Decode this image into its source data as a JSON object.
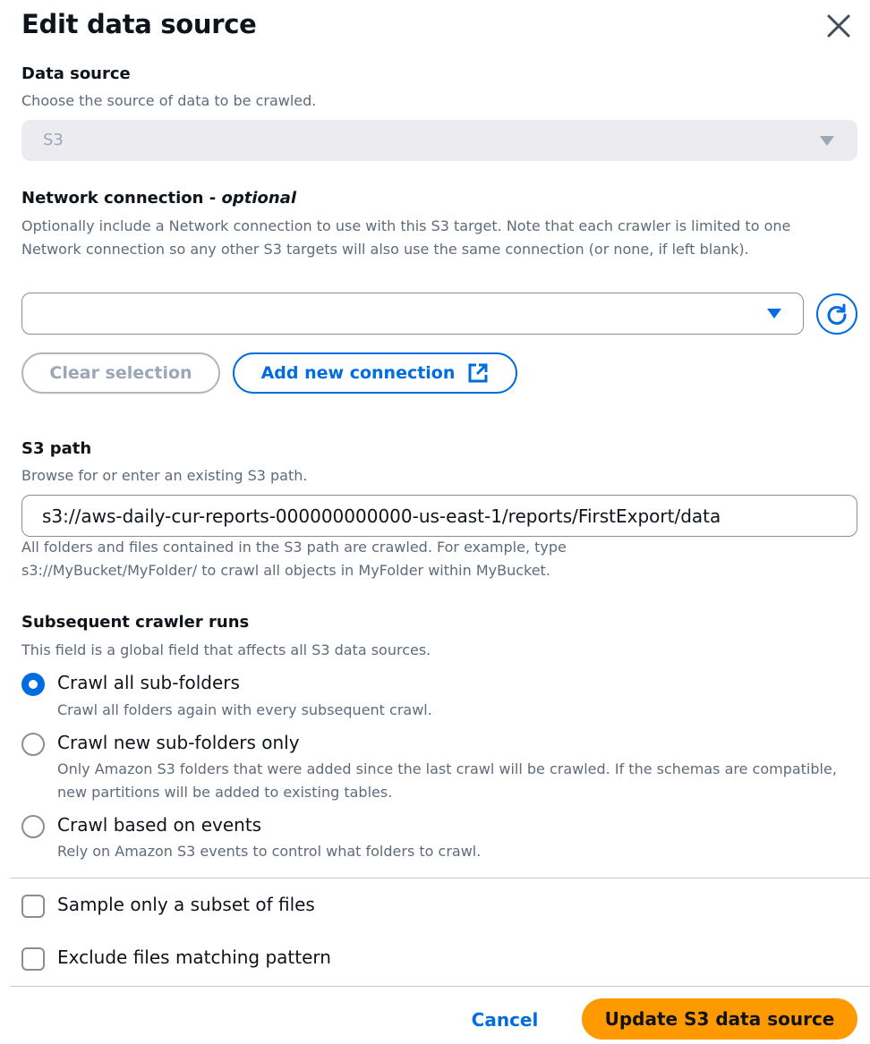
{
  "modal": {
    "title": "Edit data source",
    "close_icon": "close-icon"
  },
  "data_source": {
    "label": "Data source",
    "description": "Choose the source of data to be crawled.",
    "selected_value": "S3"
  },
  "network_connection": {
    "label": "Network connection - ",
    "optional": "optional",
    "description": "Optionally include a Network connection to use with this S3 target. Note that each crawler is limited to one Network connection so any other S3 targets will also use the same connection (or none, if left blank).",
    "selected_value": "",
    "refresh_icon": "refresh-icon",
    "clear_label": "Clear selection",
    "add_label": "Add new connection",
    "external_icon": "external-link-icon"
  },
  "s3_path": {
    "label": "S3 path",
    "description": "Browse for or enter an existing S3 path.",
    "value": "s3://aws-daily-cur-reports-000000000000-us-east-1/reports/FirstExport/data",
    "help_line1": "All folders and files contained in the S3 path are crawled. For example, type",
    "help_line2": "s3://MyBucket/MyFolder/ to crawl all objects in MyFolder within MyBucket."
  },
  "subsequent_runs": {
    "label": "Subsequent crawler runs",
    "description": "This field is a global field that affects all S3 data sources.",
    "options": [
      {
        "label": "Crawl all sub-folders",
        "description": "Crawl all folders again with every subsequent crawl.",
        "selected": true
      },
      {
        "label": "Crawl new sub-folders only",
        "description": "Only Amazon S3 folders that were added since the last crawl will be crawled. If the schemas are compatible, new partitions will be added to existing tables.",
        "selected": false
      },
      {
        "label": "Crawl based on events",
        "description": "Rely on Amazon S3 events to control what folders to crawl.",
        "selected": false
      }
    ]
  },
  "checkboxes": [
    {
      "label": "Sample only a subset of files",
      "checked": false
    },
    {
      "label": "Exclude files matching pattern",
      "checked": false
    }
  ],
  "footer": {
    "cancel_label": "Cancel",
    "submit_label": "Update S3 data source"
  },
  "colors": {
    "primary": "#ff9900",
    "accent": "#006ce0",
    "muted_text": "#5f6b7a",
    "disabled_bg": "#ebebf0"
  }
}
